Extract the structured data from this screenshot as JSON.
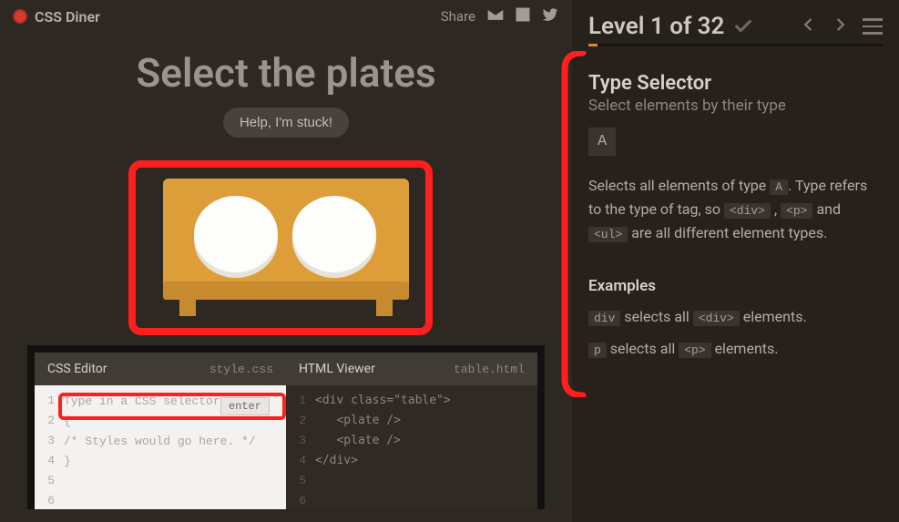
{
  "brand": {
    "name": "CSS Diner"
  },
  "share": {
    "label": "Share"
  },
  "title": "Select the plates",
  "stuck_label": "Help, I'm stuck!",
  "editors": {
    "css": {
      "title": "CSS Editor",
      "file": "style.css",
      "placeholder": "Type in a CSS selector",
      "enter": "enter",
      "lines": [
        "",
        "{",
        "/* Styles would go here. */",
        "}",
        "",
        ""
      ],
      "gutter": [
        "1",
        "2",
        "3",
        "4",
        "5",
        "6"
      ]
    },
    "html": {
      "title": "HTML Viewer",
      "file": "table.html",
      "code": "<div class=\"table\">\n   <plate />\n   <plate />\n</div>\n\n",
      "gutter": [
        "1",
        "2",
        "3",
        "4",
        "5",
        "6"
      ]
    }
  },
  "level": {
    "title": "Level 1 of 32",
    "selector_name": "Type Selector",
    "selector_sub": "Select elements by their type",
    "syntax": "A",
    "desc_pre": "Selects all elements of type ",
    "desc_code1": "A",
    "desc_mid1": ". Type refers to the type of tag, so ",
    "desc_code2": "<div>",
    "desc_sep1": " , ",
    "desc_code3": "<p>",
    "desc_and": " and ",
    "desc_code4": "<ul>",
    "desc_post": " are all different element types.",
    "examples_h": "Examples",
    "ex1_code1": "div",
    "ex1_mid": " selects all ",
    "ex1_code2": "<div>",
    "ex1_post": " elements.",
    "ex2_code1": "p",
    "ex2_mid": " selects all ",
    "ex2_code2": "<p>",
    "ex2_post": " elements."
  }
}
